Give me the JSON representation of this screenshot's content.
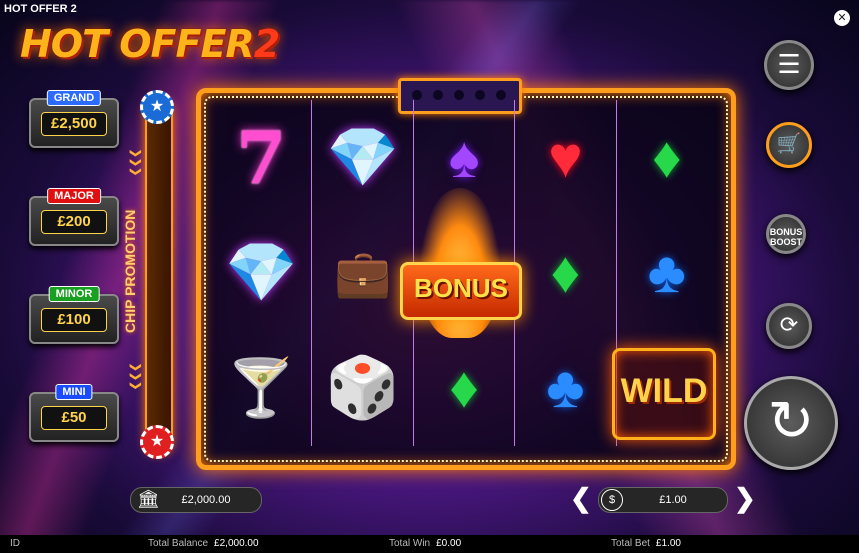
{
  "window": {
    "title": "HOT OFFER 2",
    "close_icon": "close-icon"
  },
  "logo": {
    "text_main": "HOT OFFER",
    "text_two": "2"
  },
  "jackpots": [
    {
      "label": "GRAND",
      "amount": "£2,500",
      "label_color": "#2b6cff"
    },
    {
      "label": "MAJOR",
      "amount": "£200",
      "label_color": "#e01010"
    },
    {
      "label": "MINOR",
      "amount": "£100",
      "label_color": "#18a020"
    },
    {
      "label": "MINI",
      "amount": "£50",
      "label_color": "#1a4cff"
    }
  ],
  "promotion": {
    "label": "CHIP PROMOTION",
    "chevrons": "❯❯❯"
  },
  "reels": [
    [
      "seven",
      "diamond-purple",
      "martini-glass"
    ],
    [
      "diamond-purple",
      "cash-briefcase",
      "dice"
    ],
    [
      "spade-purple",
      "bonus-flame",
      "diamond-green"
    ],
    [
      "heart-red",
      "diamond-green",
      "club-blue"
    ],
    [
      "diamond-green",
      "club-blue",
      "wild"
    ]
  ],
  "symbols": {
    "bonus": "BONUS",
    "wild": "WILD"
  },
  "controls": {
    "menu_icon": "menu-icon",
    "cart_icon": "cart-icon",
    "boost_label_1": "BONUS",
    "boost_label_2": "BOOST",
    "autoplay_icon": "autoplay-icon",
    "spin_icon": "spin-icon"
  },
  "balance_pill": {
    "icon": "bank-icon",
    "value": "£2,000.00"
  },
  "bet_pill": {
    "icon": "coin-icon",
    "value": "£1.00"
  },
  "status": {
    "id_label": "ID",
    "total_balance_label": "Total Balance",
    "total_balance_value": "£2,000.00",
    "total_win_label": "Total Win",
    "total_win_value": "£0.00",
    "total_bet_label": "Total Bet",
    "total_bet_value": "£1.00"
  },
  "colors": {
    "accent": "#ff9d1c",
    "gold": "#ffd34a",
    "frame_glow": "#ff7a00"
  }
}
